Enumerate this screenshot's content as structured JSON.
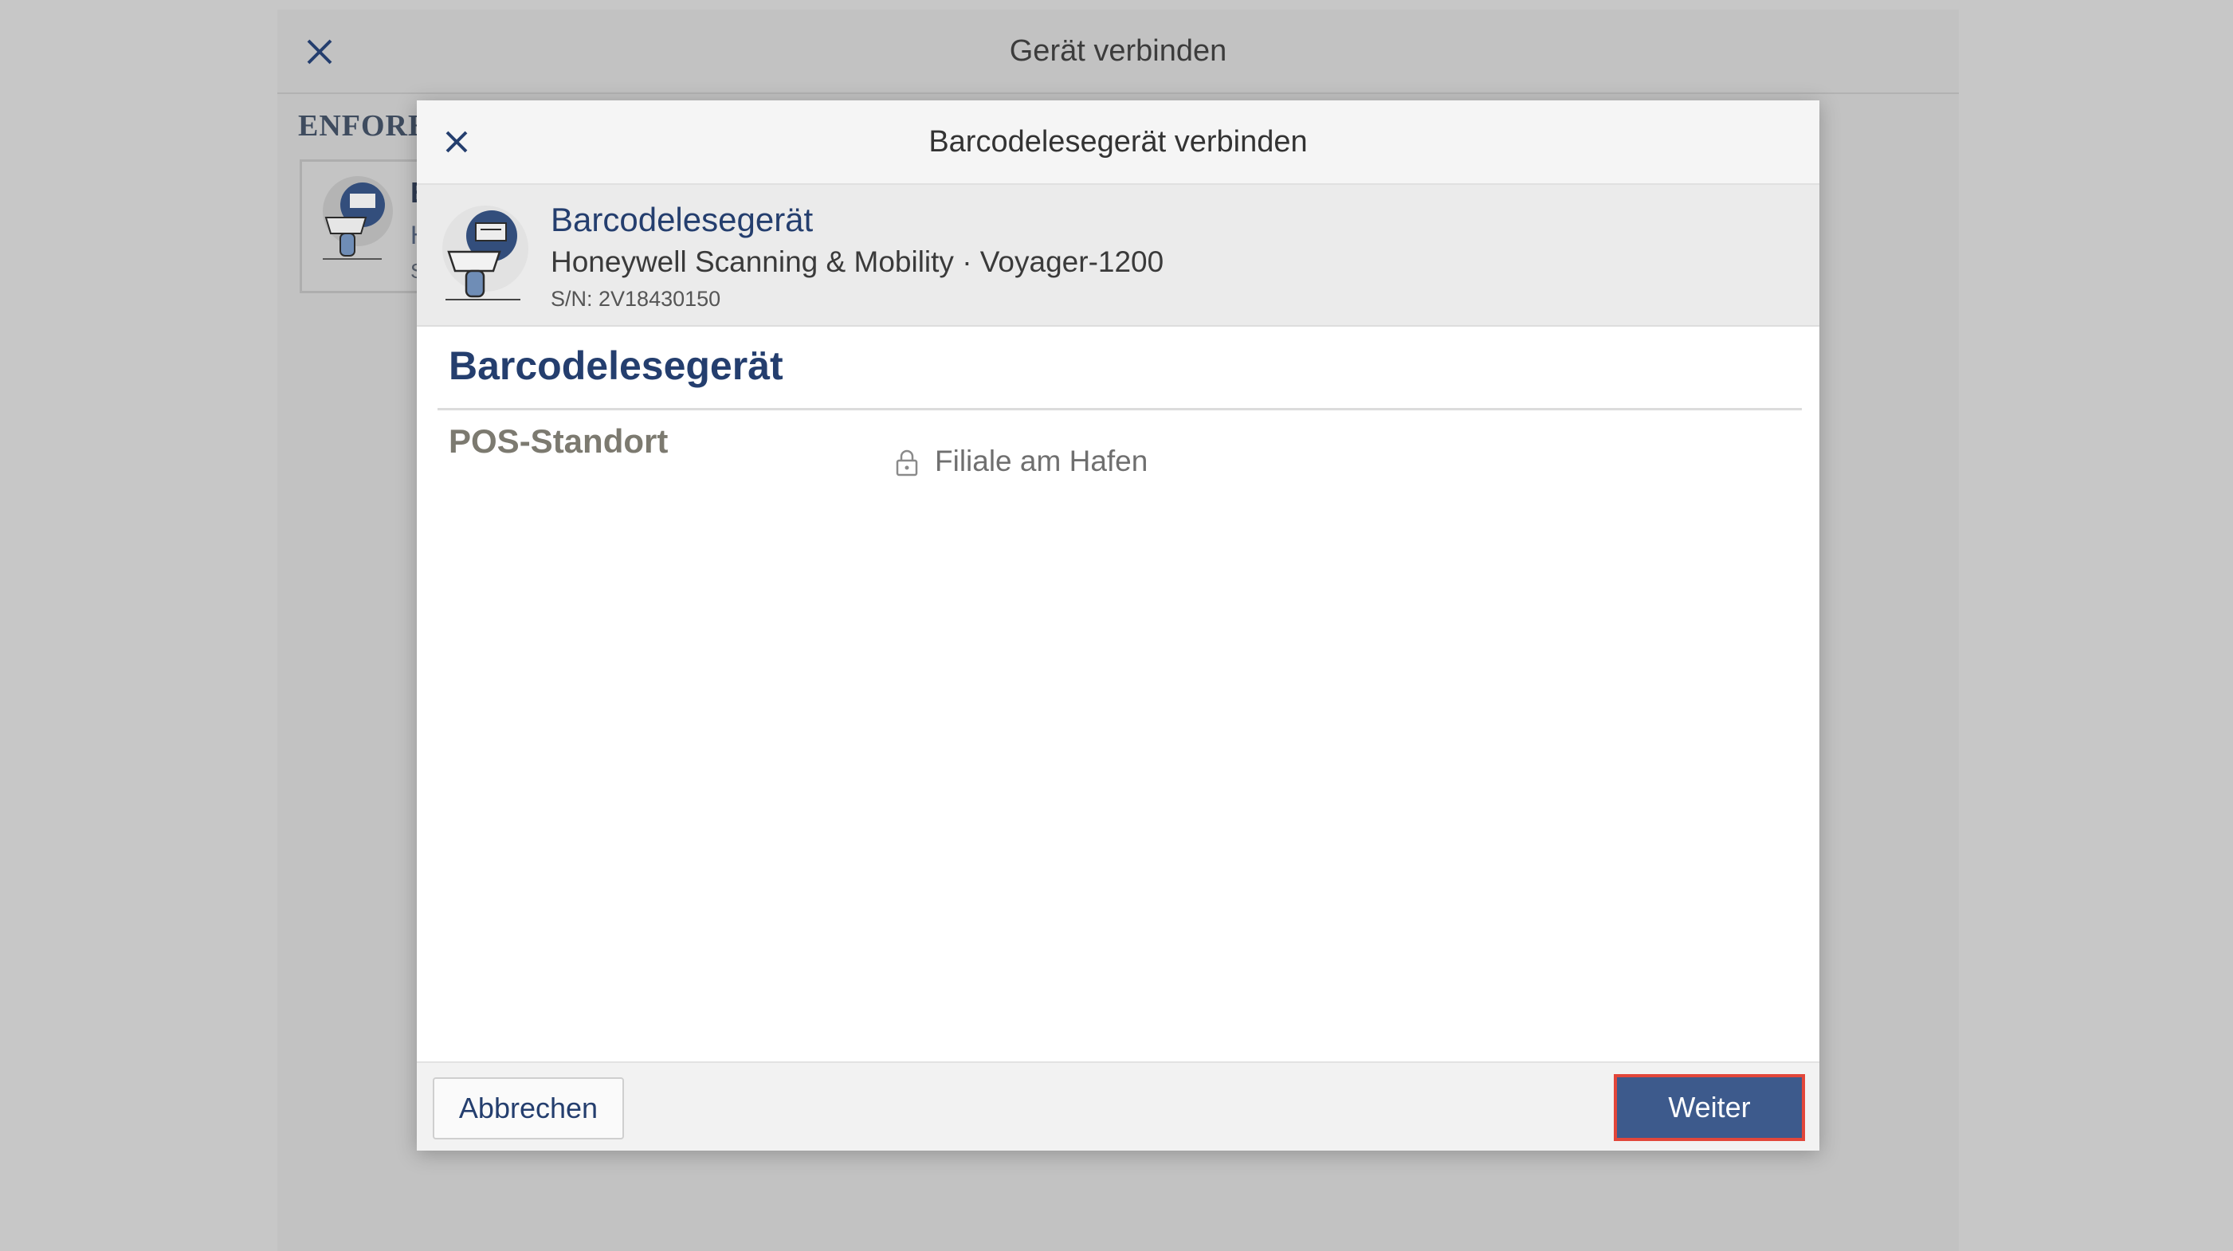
{
  "colors": {
    "overlay": "#c7c7c7",
    "brand_blue": "#243e6e",
    "button_blue": "#3d5a8c",
    "focus_outline": "#e2463a"
  },
  "outer_dialog": {
    "title": "Gerät verbinden",
    "close_icon": "close-icon",
    "section_heading": "ENFORE A",
    "card": {
      "icon": "barcode-scanner-icon",
      "line1": "B",
      "line2": "H",
      "line3": "S/"
    }
  },
  "modal": {
    "title": "Barcodelesegerät verbinden",
    "close_icon": "close-icon",
    "device": {
      "icon": "barcode-scanner-icon",
      "name": "Barcodelesegerät",
      "model": "Honeywell Scanning & Mobility · Voyager-1200",
      "serial": "S/N: 2V18430150"
    },
    "section_title": "Barcodelesegerät",
    "field": {
      "label": "POS-Standort",
      "icon": "lock-icon",
      "value": "Filiale am Hafen"
    },
    "footer": {
      "cancel_label": "Abbrechen",
      "next_label": "Weiter"
    }
  }
}
